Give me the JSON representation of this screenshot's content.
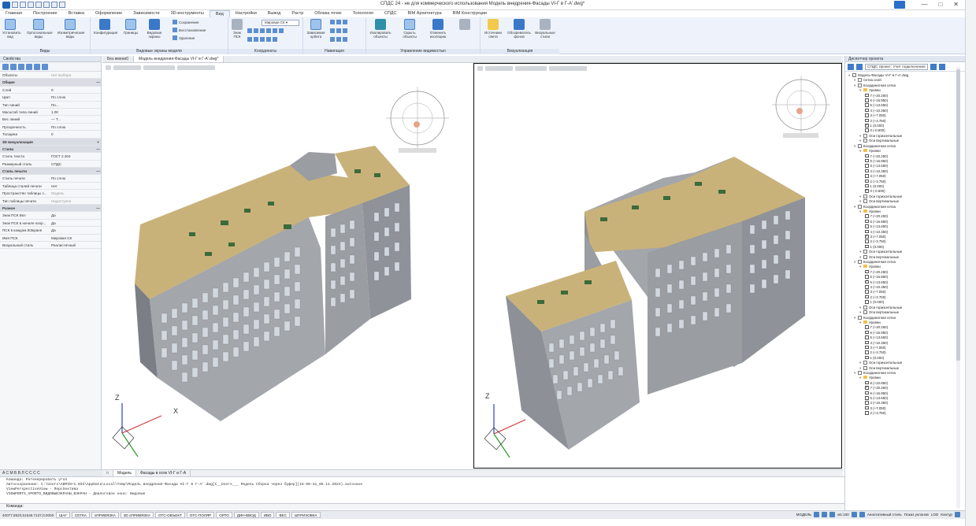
{
  "window": {
    "title": "СПДС 24 - не для коммерческого использования Модель внедрения-Фасады VI-Г в Г-А'.dwg*",
    "minimize": "—",
    "maximize": "□",
    "close": "✕"
  },
  "ribbon_tabs": [
    "Главная",
    "Построение",
    "Вставка",
    "Оформление",
    "Зависимости",
    "3D-инструменты",
    "Вид",
    "Настройки",
    "Вывод",
    "Растр",
    "Облака точек",
    "Топология",
    "СПДС",
    "BIM Архитектура",
    "BIM Конструкции"
  ],
  "ribbon": {
    "groups": {
      "views": "Виды",
      "viewports": "Видовые экраны модели",
      "coords": "Координаты",
      "nav": "Навигация",
      "visibility": "Управление видимостью",
      "visualization": "Визуализация"
    },
    "buttons": {
      "set_view": "Установить вид",
      "ortho": "Ортогональные виды",
      "iso": "Изометрические виды",
      "config": "Конфигурация",
      "bounds": "Границы",
      "vp_screens": "Видовые экраны",
      "save": "Сохранение",
      "restore": "Восстановление",
      "delete": "Удаление",
      "ucs_icon": "Знак ПСК",
      "world_cs": "Мировая СК",
      "orbit": "Зависимая орбита",
      "isolate": "Изолировать объекты",
      "hide": "Скрыть объекты",
      "end_isolation": "Отменить изоляцию",
      "lights": "Источники света",
      "sky": "Обозреватель фонов",
      "visual_styles": "Визуальные стили"
    }
  },
  "properties_panel": {
    "header": "Свойства",
    "rows": [
      {
        "k": "Объекты",
        "v": "Нет выбора",
        "muted": true
      },
      {
        "k": "Общие",
        "v": "—",
        "section": true
      },
      {
        "k": "Слой",
        "v": "0"
      },
      {
        "k": "Цвет",
        "v": "По слою"
      },
      {
        "k": "Тип линий",
        "v": "По..."
      },
      {
        "k": "Масштаб типа линий",
        "v": "1.00"
      },
      {
        "k": "Вес линий",
        "v": "— Т..."
      },
      {
        "k": "Прозрачность",
        "v": "По слою"
      },
      {
        "k": "Толщина",
        "v": "0"
      },
      {
        "k": "3D визуализация",
        "v": "+",
        "section": true
      },
      {
        "k": "Стили",
        "v": "—",
        "section": true
      },
      {
        "k": "Стиль текста",
        "v": "ГОСТ 2.304"
      },
      {
        "k": "Размерный стиль",
        "v": "СПДС"
      },
      {
        "k": "Стиль печати",
        "v": "—",
        "section": true
      },
      {
        "k": "Стиль печати",
        "v": "По слою"
      },
      {
        "k": "Таблица стилей печати",
        "v": "Нет"
      },
      {
        "k": "Пространство таблицы с...",
        "v": "Модель",
        "muted": true
      },
      {
        "k": "Тип таблицы печати",
        "v": "Недоступно",
        "muted": true
      },
      {
        "k": "Разное",
        "v": "—",
        "section": true
      },
      {
        "k": "Знак ПСК Вкл",
        "v": "Да"
      },
      {
        "k": "Знак ПСК в начале коор...",
        "v": "Да"
      },
      {
        "k": "ПСК в каждом ВЭкране",
        "v": "Да"
      },
      {
        "k": "Имя ПСК",
        "v": "Мировая СК"
      },
      {
        "k": "Визуальный стиль",
        "v": "Реалистичный"
      }
    ]
  },
  "document_tabs": [
    "Без имени0",
    "Модель внедрения-Фасады VI-Г в Г-А'.dwg*"
  ],
  "model_tabs": [
    "Модель",
    "Фасады в осях VI-Г и Г-А"
  ],
  "layout_strip": "A C M Б В Л С С С С",
  "axis_labels": {
    "x": "X",
    "y": "Y",
    "z": "Z"
  },
  "command_history": [
    "Команда: Регенерировать угол",
    "Автосохранение: C:\\Users\\ADMIN~1.NIS\\AppData\\Local\\Temp\\Модель внедрения-Фасады VI-Г в Г-А'.dwg[C__Users___ Модель Сборка через буфер](15-50-41_05.11.2024).autosave",
    "ViewPerspectiveView - Перспектива",
    "VIEWPORTS_VPORTS_ВИДОВЫЕЭКРАНЫ_ВЭКРАН - Диалоговое окно: Видовые"
  ],
  "command_prompt": "Команда:",
  "status_bar": {
    "coords": "40077.8620,51546.7127,0.0000",
    "toggles": [
      "ШАГ",
      "СЕТКА",
      "оПРИВЯЗКА",
      "3D оПРИВЯЗКА",
      "ОТС-ОБЪЕКТ",
      "ОТС-ПОЛЯР",
      "ОРТО",
      "ДИН-ВВОД",
      "ИВО",
      "ВЕС",
      "ШТРИХОВКА"
    ],
    "space": "МОДЕЛЬ",
    "scale": "м1:100",
    "annotation": "Аннотативный стиль",
    "show_scales": "Показ уклонов",
    "lod": "LOD",
    "contour": "Контур"
  },
  "project_tree": {
    "header": "Диспетчер проекта",
    "filter_label": "СПДС проект: Учет подключения",
    "nodes": [
      {
        "t": "Модель-Фасады VI-Г в Г-А'.dwg",
        "d": 0,
        "kind": "file"
      },
      {
        "t": "Сетка осей",
        "d": 1,
        "kind": "grid"
      },
      {
        "t": "Координатная сетка",
        "d": 1,
        "kind": "grid"
      },
      {
        "t": "Уровни",
        "d": 2,
        "kind": "folder"
      },
      {
        "t": "7 (+20.250)",
        "d": 3,
        "kind": "cb"
      },
      {
        "t": "6 (+16.950)",
        "d": 3,
        "kind": "cb"
      },
      {
        "t": "5 (+13.650)",
        "d": 3,
        "kind": "cb"
      },
      {
        "t": "4 (+10.350)",
        "d": 3,
        "kind": "cb"
      },
      {
        "t": "3 (+7.050)",
        "d": 3,
        "kind": "cb"
      },
      {
        "t": "2 (+3.750)",
        "d": 3,
        "kind": "cb"
      },
      {
        "t": "1 (0.000)",
        "d": 3,
        "kind": "cb",
        "on": true
      },
      {
        "t": "0 (-0.600)",
        "d": 3,
        "kind": "cb"
      },
      {
        "t": "Оси горизонтальные",
        "d": 2,
        "kind": "grid"
      },
      {
        "t": "Оси вертикальные",
        "d": 2,
        "kind": "grid"
      },
      {
        "t": "Координатная сетка",
        "d": 1,
        "kind": "grid"
      },
      {
        "t": "Уровни",
        "d": 2,
        "kind": "folder"
      },
      {
        "t": "7 (+20.250)",
        "d": 3,
        "kind": "cb"
      },
      {
        "t": "6 (+16.950)",
        "d": 3,
        "kind": "cb"
      },
      {
        "t": "5 (+13.650)",
        "d": 3,
        "kind": "cb"
      },
      {
        "t": "4 (+10.350)",
        "d": 3,
        "kind": "cb"
      },
      {
        "t": "3 (+7.050)",
        "d": 3,
        "kind": "cb"
      },
      {
        "t": "2 (+3.750)",
        "d": 3,
        "kind": "cb"
      },
      {
        "t": "1 (0.000)",
        "d": 3,
        "kind": "cb"
      },
      {
        "t": "0 (-0.600)",
        "d": 3,
        "kind": "cb",
        "on": true
      },
      {
        "t": "Оси горизонтальные",
        "d": 2,
        "kind": "grid"
      },
      {
        "t": "Оси вертикальные",
        "d": 2,
        "kind": "grid"
      },
      {
        "t": "Координатная сетка",
        "d": 1,
        "kind": "grid"
      },
      {
        "t": "Уровни",
        "d": 2,
        "kind": "folder"
      },
      {
        "t": "7 (+20.250)",
        "d": 3,
        "kind": "cb"
      },
      {
        "t": "6 (+16.950)",
        "d": 3,
        "kind": "cb"
      },
      {
        "t": "5 (+13.650)",
        "d": 3,
        "kind": "cb"
      },
      {
        "t": "4 (+10.350)",
        "d": 3,
        "kind": "cb"
      },
      {
        "t": "3 (+7.050)",
        "d": 3,
        "kind": "cb",
        "on": true
      },
      {
        "t": "2 (+3.750)",
        "d": 3,
        "kind": "cb"
      },
      {
        "t": "1 (0.000)",
        "d": 3,
        "kind": "cb"
      },
      {
        "t": "Оси горизонтальные",
        "d": 2,
        "kind": "grid"
      },
      {
        "t": "Оси вертикальные",
        "d": 2,
        "kind": "grid"
      },
      {
        "t": "Координатная сетка",
        "d": 1,
        "kind": "grid"
      },
      {
        "t": "Уровни",
        "d": 2,
        "kind": "folder"
      },
      {
        "t": "7 (+20.250)",
        "d": 3,
        "kind": "cb"
      },
      {
        "t": "6 (+16.950)",
        "d": 3,
        "kind": "cb"
      },
      {
        "t": "5 (+13.650)",
        "d": 3,
        "kind": "cb",
        "on": true
      },
      {
        "t": "4 (+10.350)",
        "d": 3,
        "kind": "cb"
      },
      {
        "t": "3 (+7.050)",
        "d": 3,
        "kind": "cb"
      },
      {
        "t": "2 (+3.750)",
        "d": 3,
        "kind": "cb"
      },
      {
        "t": "1 (0.000)",
        "d": 3,
        "kind": "cb"
      },
      {
        "t": "Оси горизонтальные",
        "d": 2,
        "kind": "grid"
      },
      {
        "t": "Оси вертикальные",
        "d": 2,
        "kind": "grid"
      },
      {
        "t": "Координатная сетка",
        "d": 1,
        "kind": "grid"
      },
      {
        "t": "Уровни",
        "d": 2,
        "kind": "folder"
      },
      {
        "t": "7 (+20.250)",
        "d": 3,
        "kind": "cb"
      },
      {
        "t": "6 (+16.950)",
        "d": 3,
        "kind": "cb"
      },
      {
        "t": "5 (+13.650)",
        "d": 3,
        "kind": "cb"
      },
      {
        "t": "4 (+10.350)",
        "d": 3,
        "kind": "cb"
      },
      {
        "t": "3 (+7.050)",
        "d": 3,
        "kind": "cb"
      },
      {
        "t": "2 (+3.750)",
        "d": 3,
        "kind": "cb"
      },
      {
        "t": "1 (0.000)",
        "d": 3,
        "kind": "cb"
      },
      {
        "t": "Оси горизонтальные",
        "d": 2,
        "kind": "grid"
      },
      {
        "t": "Оси вертикальные",
        "d": 2,
        "kind": "grid"
      },
      {
        "t": "Координатная сетка",
        "d": 1,
        "kind": "grid"
      },
      {
        "t": "Уровни",
        "d": 2,
        "kind": "folder"
      },
      {
        "t": "8 (+22.850)",
        "d": 3,
        "kind": "cb"
      },
      {
        "t": "7 (+20.250)",
        "d": 3,
        "kind": "cb",
        "on": true
      },
      {
        "t": "6 (+16.950)",
        "d": 3,
        "kind": "cb"
      },
      {
        "t": "5 (+13.650)",
        "d": 3,
        "kind": "cb"
      },
      {
        "t": "4 (+10.350)",
        "d": 3,
        "kind": "cb"
      },
      {
        "t": "3 (+7.050)",
        "d": 3,
        "kind": "cb"
      },
      {
        "t": "2 (+3.750)",
        "d": 3,
        "kind": "cb"
      }
    ]
  },
  "colors": {
    "roof": "#c9b27a",
    "facade": "#a9acb1",
    "window": "#cfd6de",
    "accent": "#2a6fc8"
  }
}
